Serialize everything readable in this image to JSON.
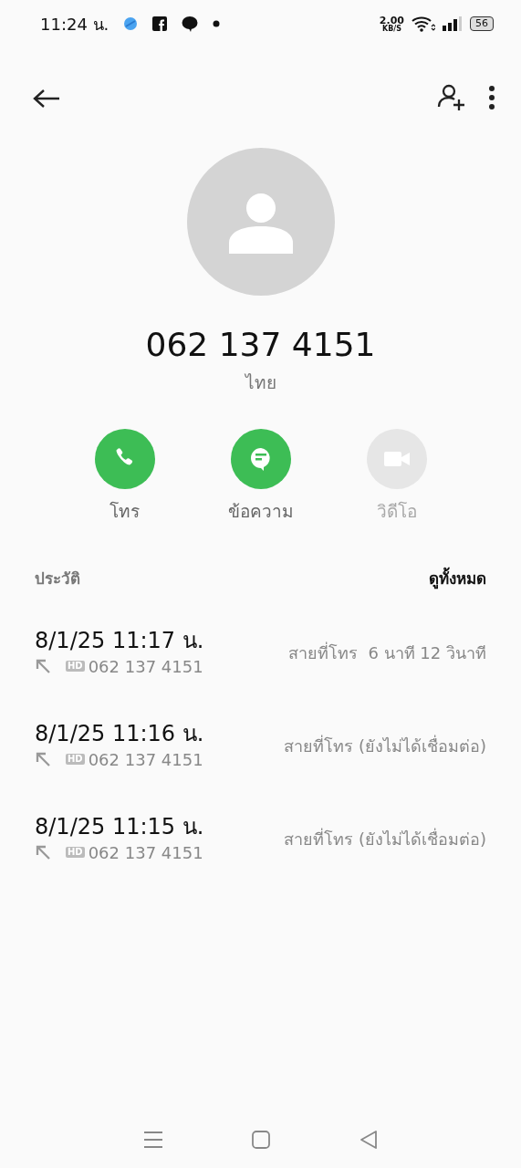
{
  "status_bar": {
    "time": "11:24 น.",
    "speed": "2.00",
    "speed_unit": "KB/S",
    "battery": "56"
  },
  "contact": {
    "number": "062 137 4151",
    "location": "ไทย"
  },
  "actions": [
    {
      "kind": "call",
      "label": "โทร",
      "disabled": false
    },
    {
      "kind": "message",
      "label": "ข้อความ",
      "disabled": false
    },
    {
      "kind": "video",
      "label": "วิดีโอ",
      "disabled": true
    }
  ],
  "history": {
    "title": "ประวัติ",
    "see_all": "ดูทั้งหมด",
    "entries": [
      {
        "datetime": "8/1/25 11:17 น.",
        "badge": "HD",
        "number": "062 137 4151",
        "status": "สายที่โทร  6 นาที 12 วินาที"
      },
      {
        "datetime": "8/1/25 11:16 น.",
        "badge": "HD",
        "number": "062 137 4151",
        "status": "สายที่โทร (ยังไม่ได้เชื่อมต่อ)"
      },
      {
        "datetime": "8/1/25 11:15 น.",
        "badge": "HD",
        "number": "062 137 4151",
        "status": "สายที่โทร (ยังไม่ได้เชื่อมต่อ)"
      }
    ]
  }
}
